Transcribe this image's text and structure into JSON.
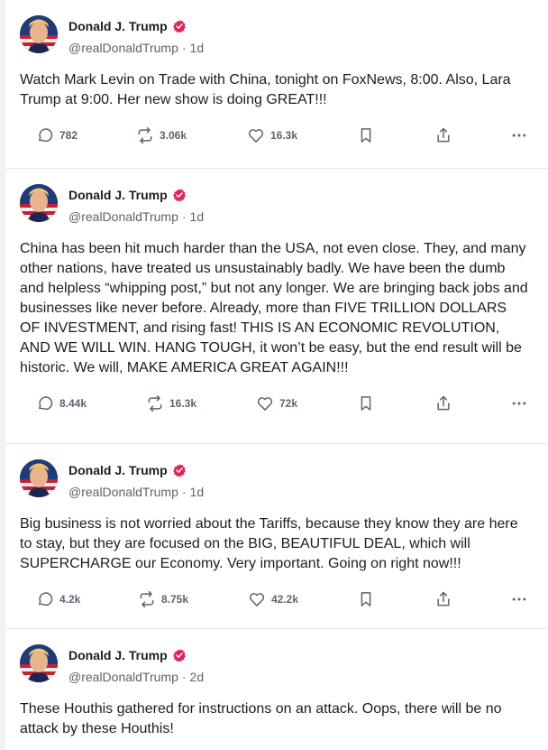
{
  "posts": [
    {
      "author": "Donald J. Trump",
      "handle": "@realDonaldTrump",
      "separator": "·",
      "time": "1d",
      "text": "Watch Mark Levin on Trade with China,  tonight on FoxNews, 8:00. Also, Lara Trump at 9:00. Her new show is doing GREAT!!!",
      "replies": "782",
      "reposts": "3.06k",
      "likes": "16.3k"
    },
    {
      "author": "Donald J. Trump",
      "handle": "@realDonaldTrump",
      "separator": "·",
      "time": "1d",
      "text": "China has been hit much harder than the USA, not even close. They, and many other nations, have treated us unsustainably badly. We have been the dumb and helpless “whipping post,” but not any longer. We are bringing back jobs and businesses like never before. Already, more than FIVE TRILLION DOLLARS OF INVESTMENT, and rising fast! THIS IS AN ECONOMIC REVOLUTION, AND WE WILL WIN. HANG TOUGH, it won’t be easy, but the end result will be historic. We will, MAKE AMERICA GREAT AGAIN!!!",
      "replies": "8.44k",
      "reposts": "16.3k",
      "likes": "72k"
    },
    {
      "author": "Donald J. Trump",
      "handle": "@realDonaldTrump",
      "separator": "·",
      "time": "1d",
      "text": "Big business is not worried about the Tariffs, because they know they are here to stay, but they are focused on the BIG, BEAUTIFUL DEAL, which will SUPERCHARGE our Economy. Very important. Going on right now!!!",
      "replies": "4.2k",
      "reposts": "8.75k",
      "likes": "42.2k"
    },
    {
      "author": "Donald J. Trump",
      "handle": "@realDonaldTrump",
      "separator": "·",
      "time": "2d",
      "text": "These Houthis gathered for instructions on an attack. Oops, there will be no attack by these Houthis!"
    }
  ],
  "icons": {
    "verified": "verified-badge-icon",
    "reply": "comment-icon",
    "repost": "repost-icon",
    "like": "heart-icon",
    "bookmark": "bookmark-icon",
    "share": "share-icon",
    "more": "more-icon"
  },
  "colors": {
    "verified_badge": "#e0245e",
    "icon_gray": "#5b6470",
    "text": "#1a1d21"
  }
}
